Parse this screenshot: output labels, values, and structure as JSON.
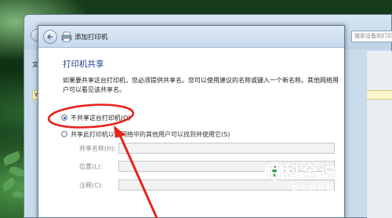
{
  "background_window": {
    "search_placeholder": "搜索设备和打印机",
    "menu_first_char": "文",
    "info_bar_char": "W"
  },
  "dialog": {
    "title": "添加打印机",
    "section_title": "打印机共享",
    "description": "如果要共享这台打印机，您必须提供共享名。您可以使用建议的名称或键入一个新名称。其他网络用户可以看见该共享名。",
    "option_no_share": "不共享这台打印机(O)",
    "option_share": "共享此打印机以便网络中的其他用户可以找到并使用它(S)",
    "share_name_label": "共享名称(H):",
    "location_label": "位置(L):",
    "comment_label": "注释(C):",
    "selected_option": "no_share"
  },
  "watermark": {
    "title": "百科全说",
    "subtitle": "助你轻松解决"
  },
  "colors": {
    "annotation_red": "#e8241c",
    "section_title_blue": "#1e3f8f"
  }
}
